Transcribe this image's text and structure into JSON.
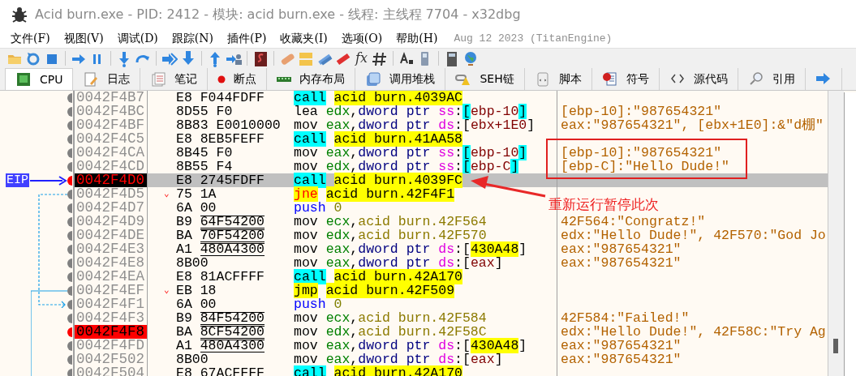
{
  "window": {
    "title": "Acid burn.exe - PID: 2412 - 模块: acid burn.exe - 线程: 主线程 7704 - x32dbg"
  },
  "menu": [
    "文件(F)",
    "视图(V)",
    "调试(D)",
    "跟踪(N)",
    "插件(P)",
    "收藏夹(I)",
    "选项(O)",
    "帮助(H)"
  ],
  "build_info": "Aug 12 2023 (TitanEngine)",
  "toolbar_function_label": "fx",
  "tabs": [
    {
      "label": "CPU",
      "kind": "cpu",
      "selected": true
    },
    {
      "label": "日志",
      "kind": "log",
      "selected": false
    },
    {
      "label": "笔记",
      "kind": "notes",
      "selected": false
    },
    {
      "label": "断点",
      "kind": "breakpoints",
      "selected": false
    },
    {
      "label": "内存布局",
      "kind": "memory",
      "selected": false
    },
    {
      "label": "调用堆栈",
      "kind": "callstack",
      "selected": false
    },
    {
      "label": "SEH链",
      "kind": "seh",
      "selected": false
    },
    {
      "label": "脚本",
      "kind": "script",
      "selected": false
    },
    {
      "label": "符号",
      "kind": "symbols",
      "selected": false
    },
    {
      "label": "源代码",
      "kind": "source",
      "selected": false
    },
    {
      "label": "引用",
      "kind": "references",
      "selected": false
    },
    {
      "kind": "trace",
      "selected": false
    }
  ],
  "rows": [
    {
      "address": "0042F4B7",
      "opcode": "E8",
      "operand": "F044FDFF",
      "relocated": false,
      "breakpoint": false,
      "current": false,
      "instruction": [
        {
          "text": "call",
          "kind": "call"
        },
        {
          "text": "acid burn.4039AC",
          "kind": "target"
        }
      ]
    },
    {
      "address": "0042F4BC",
      "opcode": "8D55",
      "operand": "F0",
      "relocated": false,
      "breakpoint": false,
      "current": false,
      "instruction": [
        {
          "text": "lea",
          "kind": "instr"
        },
        {
          "text": "edx",
          "kind": "reg"
        },
        {
          "text": ",",
          "kind": "punct"
        },
        {
          "text": "dword ptr",
          "kind": "ptr"
        },
        {
          "text": "ss",
          "kind": "seg"
        },
        {
          "text": ":",
          "kind": "punct"
        },
        {
          "text": "[",
          "kind": "bstack"
        },
        {
          "text": "ebp-10",
          "kind": "mem"
        },
        {
          "text": "]",
          "kind": "bstack"
        }
      ],
      "comment": "[ebp-10]:\"987654321\""
    },
    {
      "address": "0042F4BF",
      "opcode": "8B83",
      "operand": "E0010000",
      "relocated": false,
      "breakpoint": false,
      "current": false,
      "instruction": [
        {
          "text": "mov",
          "kind": "instr"
        },
        {
          "text": "eax",
          "kind": "reg"
        },
        {
          "text": ",",
          "kind": "punct"
        },
        {
          "text": "dword ptr",
          "kind": "ptr"
        },
        {
          "text": "ds",
          "kind": "seg"
        },
        {
          "text": ":",
          "kind": "punct"
        },
        {
          "text": "[",
          "kind": "punct"
        },
        {
          "text": "ebx+1E0",
          "kind": "mem"
        },
        {
          "text": "]",
          "kind": "punct"
        }
      ],
      "comment": "eax:\"987654321\", [ebx+1E0]:&\"d棚\""
    },
    {
      "address": "0042F4C5",
      "opcode": "E8",
      "operand": "8EB5FEFF",
      "relocated": false,
      "breakpoint": false,
      "current": false,
      "instruction": [
        {
          "text": "call",
          "kind": "call"
        },
        {
          "text": "acid burn.41AA58",
          "kind": "target"
        }
      ]
    },
    {
      "address": "0042F4CA",
      "opcode": "8B45",
      "operand": "F0",
      "relocated": false,
      "breakpoint": false,
      "current": false,
      "instruction": [
        {
          "text": "mov",
          "kind": "instr"
        },
        {
          "text": "eax",
          "kind": "reg"
        },
        {
          "text": ",",
          "kind": "punct"
        },
        {
          "text": "dword ptr",
          "kind": "ptr"
        },
        {
          "text": "ss",
          "kind": "seg"
        },
        {
          "text": ":",
          "kind": "punct"
        },
        {
          "text": "[",
          "kind": "bstack"
        },
        {
          "text": "ebp-10",
          "kind": "mem"
        },
        {
          "text": "]",
          "kind": "bstack"
        }
      ],
      "comment": "[ebp-10]:\"987654321\""
    },
    {
      "address": "0042F4CD",
      "opcode": "8B55",
      "operand": "F4",
      "relocated": false,
      "breakpoint": false,
      "current": false,
      "instruction": [
        {
          "text": "mov",
          "kind": "instr"
        },
        {
          "text": "edx",
          "kind": "reg"
        },
        {
          "text": ",",
          "kind": "punct"
        },
        {
          "text": "dword ptr",
          "kind": "ptr"
        },
        {
          "text": "ss",
          "kind": "seg"
        },
        {
          "text": ":",
          "kind": "punct"
        },
        {
          "text": "[",
          "kind": "bstack"
        },
        {
          "text": "ebp-C",
          "kind": "mem"
        },
        {
          "text": "]",
          "kind": "bstack"
        }
      ],
      "comment": "[ebp-C]:\"Hello Dude!\""
    },
    {
      "address": "0042F4D0",
      "opcode": "E8",
      "operand": "2745FDFF",
      "relocated": false,
      "breakpoint": true,
      "current": true,
      "eip_label": "EIP",
      "instruction": [
        {
          "text": "call",
          "kind": "call"
        },
        {
          "text": "acid burn.4039FC",
          "kind": "target"
        }
      ]
    },
    {
      "address": "0042F4D5",
      "opcode": "75",
      "operand": "1A",
      "relocated": false,
      "jump_mark": "⌄",
      "jump_out": {
        "kind": "dashed"
      },
      "breakpoint": false,
      "current": false,
      "instruction": [
        {
          "text": "jne",
          "kind": "jcc"
        },
        {
          "text": "acid burn.42F4F1",
          "kind": "target"
        }
      ]
    },
    {
      "address": "0042F4D7",
      "opcode": "6A",
      "operand": "00",
      "relocated": false,
      "breakpoint": false,
      "current": false,
      "instruction": [
        {
          "text": "push",
          "kind": "push"
        },
        {
          "text": "0",
          "kind": "num"
        }
      ]
    },
    {
      "address": "0042F4D9",
      "opcode": "B9",
      "operand": "64F54200",
      "relocated": true,
      "breakpoint": false,
      "current": false,
      "instruction": [
        {
          "text": "mov",
          "kind": "instr"
        },
        {
          "text": "ecx",
          "kind": "reg"
        },
        {
          "text": ",",
          "kind": "punct"
        },
        {
          "text": "acid burn.42F564",
          "kind": "sym"
        }
      ],
      "comment": "42F564:\"Congratz!\""
    },
    {
      "address": "0042F4DE",
      "opcode": "BA",
      "operand": "70F54200",
      "relocated": true,
      "breakpoint": false,
      "current": false,
      "instruction": [
        {
          "text": "mov",
          "kind": "instr"
        },
        {
          "text": "edx",
          "kind": "reg"
        },
        {
          "text": ",",
          "kind": "punct"
        },
        {
          "text": "acid burn.42F570",
          "kind": "sym"
        }
      ],
      "comment": "edx:\"Hello Dude!\", 42F570:\"God Jo"
    },
    {
      "address": "0042F4E3",
      "opcode": "A1",
      "operand": "480A4300",
      "relocated": true,
      "breakpoint": false,
      "current": false,
      "instruction": [
        {
          "text": "mov",
          "kind": "instr"
        },
        {
          "text": "eax",
          "kind": "reg"
        },
        {
          "text": ",",
          "kind": "punct"
        },
        {
          "text": "dword ptr",
          "kind": "ptr"
        },
        {
          "text": "ds",
          "kind": "seg"
        },
        {
          "text": ":",
          "kind": "punct"
        },
        {
          "text": "[",
          "kind": "punct"
        },
        {
          "text": "430A48",
          "kind": "target"
        },
        {
          "text": "]",
          "kind": "punct"
        }
      ],
      "comment": "eax:\"987654321\""
    },
    {
      "address": "0042F4E8",
      "opcode": "8B00",
      "breakpoint": false,
      "current": false,
      "instruction": [
        {
          "text": "mov",
          "kind": "instr"
        },
        {
          "text": "eax",
          "kind": "reg"
        },
        {
          "text": ",",
          "kind": "punct"
        },
        {
          "text": "dword ptr",
          "kind": "ptr"
        },
        {
          "text": "ds",
          "kind": "seg"
        },
        {
          "text": ":",
          "kind": "punct"
        },
        {
          "text": "[",
          "kind": "punct"
        },
        {
          "text": "eax",
          "kind": "mem"
        },
        {
          "text": "]",
          "kind": "punct"
        }
      ],
      "comment": "eax:\"987654321\""
    },
    {
      "address": "0042F4EA",
      "opcode": "E8",
      "operand": "81ACFFFF",
      "relocated": false,
      "breakpoint": false,
      "current": false,
      "instruction": [
        {
          "text": "call",
          "kind": "call"
        },
        {
          "text": "acid burn.42A170",
          "kind": "target"
        }
      ]
    },
    {
      "address": "0042F4EF",
      "opcode": "EB",
      "operand": "18",
      "relocated": false,
      "jump_mark": "⌄",
      "jump_out": {
        "kind": "solid"
      },
      "breakpoint": false,
      "current": false,
      "instruction": [
        {
          "text": "jmp",
          "kind": "jmp"
        },
        {
          "text": "acid burn.42F509",
          "kind": "target"
        }
      ]
    },
    {
      "address": "0042F4F1",
      "opcode": "6A",
      "operand": "00",
      "relocated": false,
      "jump_in": {
        "kind": "dashed"
      },
      "breakpoint": false,
      "current": false,
      "instruction": [
        {
          "text": "push",
          "kind": "push"
        },
        {
          "text": "0",
          "kind": "num"
        }
      ]
    },
    {
      "address": "0042F4F3",
      "opcode": "B9",
      "operand": "84F54200",
      "relocated": true,
      "breakpoint": false,
      "current": false,
      "instruction": [
        {
          "text": "mov",
          "kind": "instr"
        },
        {
          "text": "ecx",
          "kind": "reg"
        },
        {
          "text": ",",
          "kind": "punct"
        },
        {
          "text": "acid burn.42F584",
          "kind": "sym"
        }
      ],
      "comment": "42F584:\"Failed!\""
    },
    {
      "address": "0042F4F8",
      "opcode": "BA",
      "operand": "8CF54200",
      "relocated": true,
      "breakpoint": true,
      "current": false,
      "instruction": [
        {
          "text": "mov",
          "kind": "instr"
        },
        {
          "text": "edx",
          "kind": "reg"
        },
        {
          "text": ",",
          "kind": "punct"
        },
        {
          "text": "acid burn.42F58C",
          "kind": "sym"
        }
      ],
      "comment": "edx:\"Hello Dude!\", 42F58C:\"Try Ag"
    },
    {
      "address": "0042F4FD",
      "opcode": "A1",
      "operand": "480A4300",
      "relocated": true,
      "breakpoint": false,
      "current": false,
      "instruction": [
        {
          "text": "mov",
          "kind": "instr"
        },
        {
          "text": "eax",
          "kind": "reg"
        },
        {
          "text": ",",
          "kind": "punct"
        },
        {
          "text": "dword ptr",
          "kind": "ptr"
        },
        {
          "text": "ds",
          "kind": "seg"
        },
        {
          "text": ":",
          "kind": "punct"
        },
        {
          "text": "[",
          "kind": "punct"
        },
        {
          "text": "430A48",
          "kind": "target"
        },
        {
          "text": "]",
          "kind": "punct"
        }
      ],
      "comment": "eax:\"987654321\""
    },
    {
      "address": "0042F502",
      "opcode": "8B00",
      "breakpoint": false,
      "current": false,
      "instruction": [
        {
          "text": "mov",
          "kind": "instr"
        },
        {
          "text": "eax",
          "kind": "reg"
        },
        {
          "text": ",",
          "kind": "punct"
        },
        {
          "text": "dword ptr",
          "kind": "ptr"
        },
        {
          "text": "ds",
          "kind": "seg"
        },
        {
          "text": ":",
          "kind": "punct"
        },
        {
          "text": "[",
          "kind": "punct"
        },
        {
          "text": "eax",
          "kind": "mem"
        },
        {
          "text": "]",
          "kind": "punct"
        }
      ],
      "comment": "eax:\"987654321\""
    },
    {
      "address": "0042F504",
      "opcode": "E8",
      "operand": "67ACFFFF",
      "relocated": false,
      "breakpoint": false,
      "current": false,
      "instruction": [
        {
          "text": "call",
          "kind": "call"
        },
        {
          "text": "acid burn.42A170",
          "kind": "target"
        }
      ]
    }
  ],
  "annotation": {
    "note": "重新运行暂停此次"
  }
}
